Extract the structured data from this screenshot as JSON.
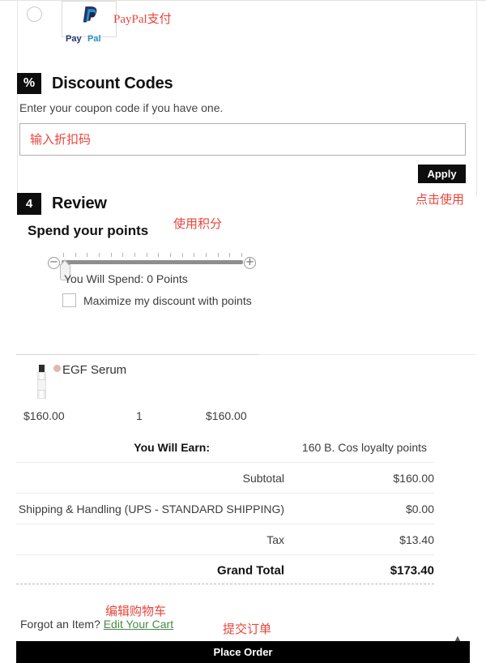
{
  "payment": {
    "method_radio": "paypal-radio",
    "logo_alt": "PayPal",
    "logo_word_1": "Pay",
    "logo_word_2": "Pal",
    "annotation": "PayPal支付"
  },
  "discount": {
    "badge": "%",
    "title": "Discount Codes",
    "subtitle": "Enter your coupon code if you have one.",
    "input_value": "",
    "input_placeholder": "输入折扣码",
    "apply_label": "Apply",
    "apply_annotation": "点击使用"
  },
  "review": {
    "badge": "4",
    "title": "Review",
    "points_title": "Spend your points",
    "points_annotation": "使用积分",
    "slider": {
      "minus": "−",
      "plus": "+",
      "tick_count": 16,
      "value_position_percent": 0
    },
    "spend_label": "You Will Spend: 0 Points",
    "maximize_label": "Maximize my discount with points"
  },
  "cart": {
    "product": {
      "name": "EGF Serum",
      "thumb": "serum-bottle-thumbnail",
      "swatch_color": "#e3b7ab",
      "price": "$160.00",
      "qty": "1",
      "subtotal": "$160.00"
    },
    "totals": [
      {
        "label": "You Will Earn:",
        "value": "160 B. Cos loyalty points",
        "kind": "earn"
      },
      {
        "label": "Subtotal",
        "value": "$160.00",
        "kind": "normal"
      },
      {
        "label": "Shipping & Handling (UPS - STANDARD SHIPPING)",
        "value": "$0.00",
        "kind": "normal"
      },
      {
        "label": "Tax",
        "value": "$13.40",
        "kind": "normal"
      },
      {
        "label": "Grand Total",
        "value": "$173.40",
        "kind": "grand"
      }
    ]
  },
  "footer": {
    "forgot_text": "Forgot an Item?",
    "edit_link": "Edit Your Cart",
    "edit_annotation": "编辑购物车",
    "place_order_label": "Place Order",
    "place_order_annotation": "提交订单",
    "scroll_top_icon": "▲"
  },
  "colors": {
    "accent_black": "#000000",
    "annotation_red": "#e8453c",
    "link_green": "#4a8a4a"
  }
}
